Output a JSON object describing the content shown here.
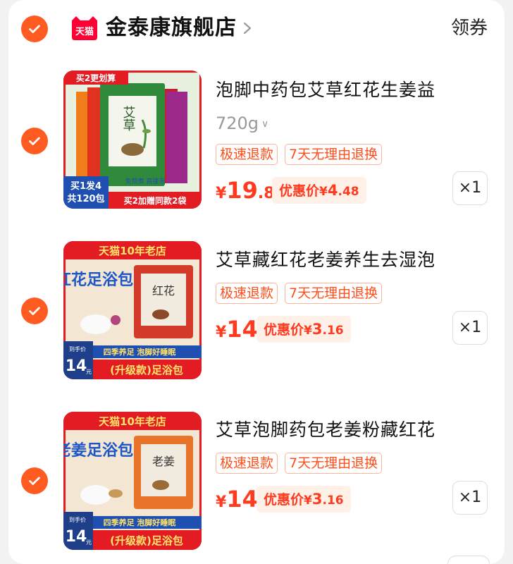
{
  "store": {
    "name": "金泰康旗舰店",
    "logo_text": "天猫",
    "coupon_label": "领券",
    "brand_color": "#ff0036"
  },
  "accent_color": "#ff5a1f",
  "items": [
    {
      "title": "泡脚中药包艾草红花生姜益",
      "spec": "720g",
      "tags": [
        "极速退款",
        "7天无理由退换"
      ],
      "price": {
        "currency": "¥",
        "int": "19",
        "dec": ".8"
      },
      "promo": {
        "label": "优惠价",
        "currency": "¥",
        "int": "4",
        "dec": ".48"
      },
      "qty": "×1",
      "image": {
        "banner": "买2更划算",
        "pack_label": "艾草",
        "offer_main": "买1发4",
        "offer_sub": "共120包",
        "note": "免煎煮 直接泡",
        "bottom": "买2加赠同款2袋"
      }
    },
    {
      "title": "艾草藏红花老姜养生去湿泡",
      "tags": [
        "极速退款",
        "7天无理由退换"
      ],
      "price": {
        "currency": "¥",
        "int": "14",
        "dec": ""
      },
      "promo": {
        "label": "优惠价",
        "currency": "¥",
        "int": "3",
        "dec": ".16"
      },
      "qty": "×1",
      "image": {
        "banner": "天猫10年老店",
        "headline": "红花足浴包",
        "pack_label": "红花",
        "strip": "四季养足 泡脚好睡眠",
        "price_tag": "到手价",
        "price_big": "14",
        "price_unit": "元",
        "bottom": "(升级款)足浴包"
      }
    },
    {
      "title": "艾草泡脚药包老姜粉藏红花",
      "tags": [
        "极速退款",
        "7天无理由退换"
      ],
      "price": {
        "currency": "¥",
        "int": "14",
        "dec": ""
      },
      "promo": {
        "label": "优惠价",
        "currency": "¥",
        "int": "3",
        "dec": ".16"
      },
      "qty": "×1",
      "image": {
        "banner": "天猫10年老店",
        "headline": "老姜足浴包",
        "pack_label": "老姜",
        "strip": "四季养足 泡脚好睡眠",
        "price_tag": "到手价",
        "price_big": "14",
        "price_unit": "元",
        "bottom": "(升级款)足浴包"
      }
    }
  ]
}
